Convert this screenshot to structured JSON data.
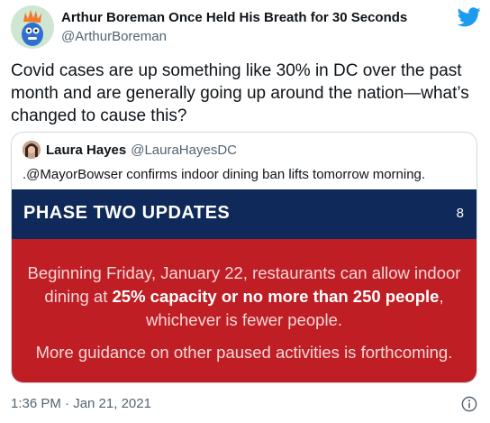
{
  "author": {
    "name": "Arthur Boreman Once Held His Breath for 30 Seconds",
    "handle": "@ArthurBoreman"
  },
  "tweet_text": "Covid cases are up something like 30% in DC over the past month and are generally going up around the nation—what’s changed to cause this?",
  "quote": {
    "name": "Laura Hayes",
    "handle": "@LauraHayesDC",
    "text": ".@MayorBowser confirms indoor dining ban lifts tomorrow morning.",
    "slide": {
      "title": "PHASE TWO UPDATES",
      "number": "8",
      "para1_a": "Beginning Friday, January 22, restaurants can allow indoor dining at ",
      "para1_bold": "25% capacity or no more than 250 people",
      "para1_b": ", whichever is fewer people.",
      "para2": "More guidance on other paused activities is forthcoming."
    }
  },
  "timestamp": "1:36 PM · Jan 21, 2021",
  "colors": {
    "twitter_blue": "#1d9bf0",
    "slide_header": "#0f2a5a",
    "slide_body": "#be1e24"
  },
  "icons": [
    "twitter-bird-icon",
    "info-icon"
  ]
}
